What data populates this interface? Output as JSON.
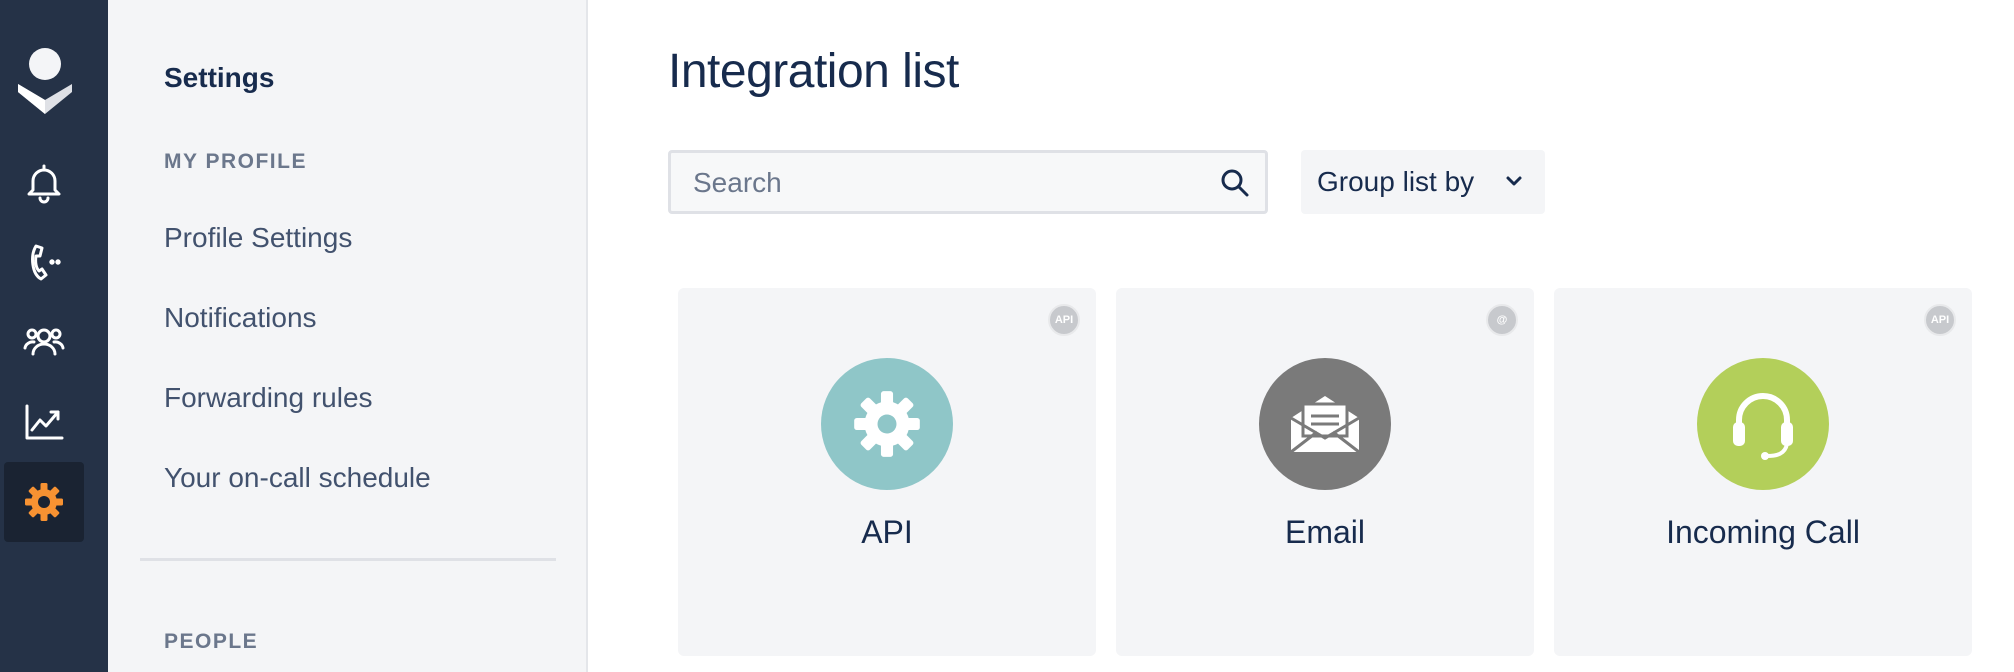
{
  "rail": {
    "logo_icon": "opsgenie-logo",
    "items": [
      {
        "icon": "bell-icon"
      },
      {
        "icon": "phone-icon"
      },
      {
        "icon": "team-icon"
      },
      {
        "icon": "chart-icon"
      },
      {
        "icon": "gear-icon",
        "active": true,
        "color": "#f79232"
      }
    ]
  },
  "sidebar": {
    "title": "Settings",
    "sections": [
      {
        "label": "MY PROFILE",
        "items": [
          "Profile Settings",
          "Notifications",
          "Forwarding rules",
          "Your on-call schedule"
        ]
      },
      {
        "label": "PEOPLE",
        "items": []
      }
    ]
  },
  "main": {
    "title": "Integration list",
    "search": {
      "placeholder": "Search",
      "value": ""
    },
    "group_by_label": "Group list by",
    "cards": [
      {
        "name": "API",
        "badge": "API",
        "icon": "gear-icon",
        "color": "#8fc6c8"
      },
      {
        "name": "Email",
        "badge": "@",
        "icon": "envelope-icon",
        "color": "#7a7a7a"
      },
      {
        "name": "Incoming Call",
        "badge": "API",
        "icon": "headset-icon",
        "color": "#b3cf5a"
      }
    ]
  }
}
